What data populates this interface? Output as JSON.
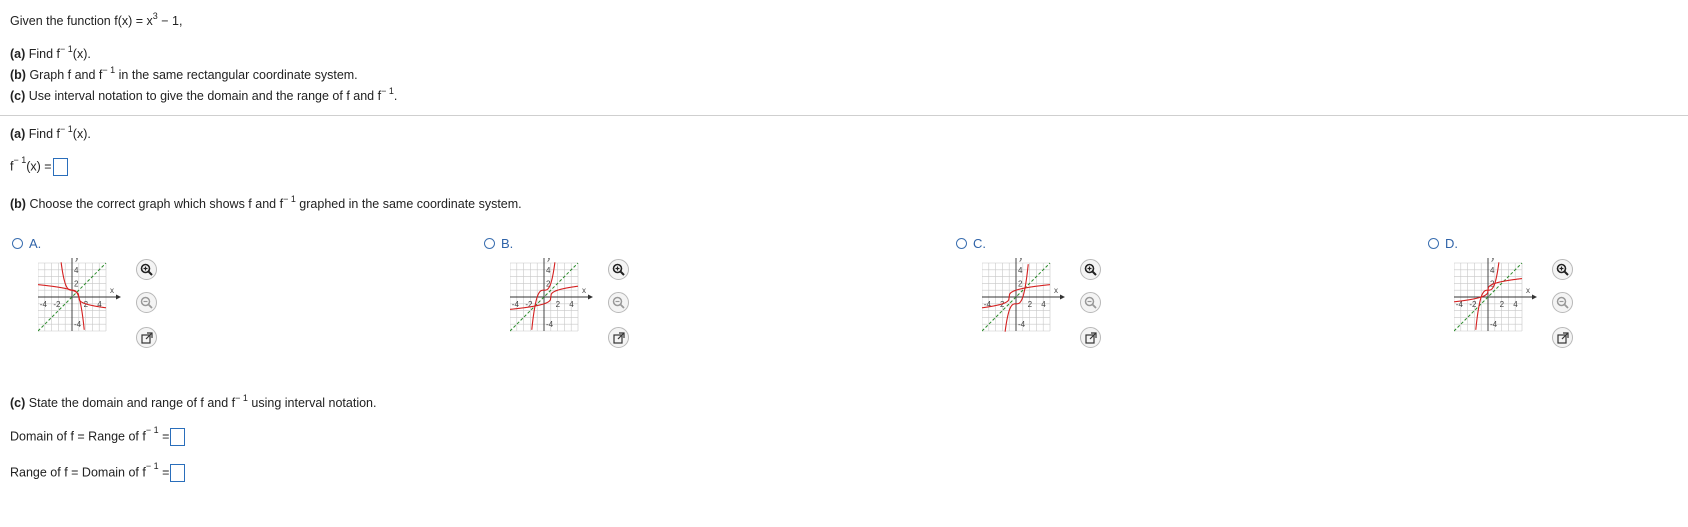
{
  "question": {
    "stem_prefix": "Given the function f(x) = x",
    "stem_exp": "3",
    "stem_suffix": " − 1,",
    "part_a_label": "(a)",
    "part_a_text": " Find f",
    "part_a_rest": "(x).",
    "part_b_label": "(b)",
    "part_b_text": " Graph f and f",
    "part_b_rest": " in the same rectangular coordinate system.",
    "part_c_label": "(c)",
    "part_c_text": " Use interval notation to give the domain and the range of f and f",
    "part_c_rest": ".",
    "inverse_sup": "− 1"
  },
  "part_a": {
    "label": "(a)",
    "text": " Find f",
    "rest": "(x).",
    "answer_prefix": "f",
    "answer_suffix": "(x) ="
  },
  "part_b": {
    "label": "(b)",
    "text": " Choose the correct graph which shows f and f",
    "rest": " graphed in the same coordinate system."
  },
  "options": [
    {
      "letter": "A."
    },
    {
      "letter": "B."
    },
    {
      "letter": "C."
    },
    {
      "letter": "D."
    }
  ],
  "graph_labels": {
    "y": "y",
    "x": "x",
    "n4": "-4",
    "n2": "-2",
    "p2": "2",
    "p4": "4"
  },
  "part_c": {
    "label": "(c)",
    "text": " State the domain and range of f and f",
    "rest": " using interval notation.",
    "domain_label": "Domain of f = Range of f",
    "range_label": "Range of f = Domain of f",
    "eq": " ="
  },
  "colors": {
    "accent": "#2f63a8",
    "curve": "#d42020",
    "line": "#2a8a2a",
    "divider": "#cfcfcf"
  },
  "icons": [
    "zoom-in-icon",
    "zoom-out-icon",
    "open-external-icon"
  ]
}
